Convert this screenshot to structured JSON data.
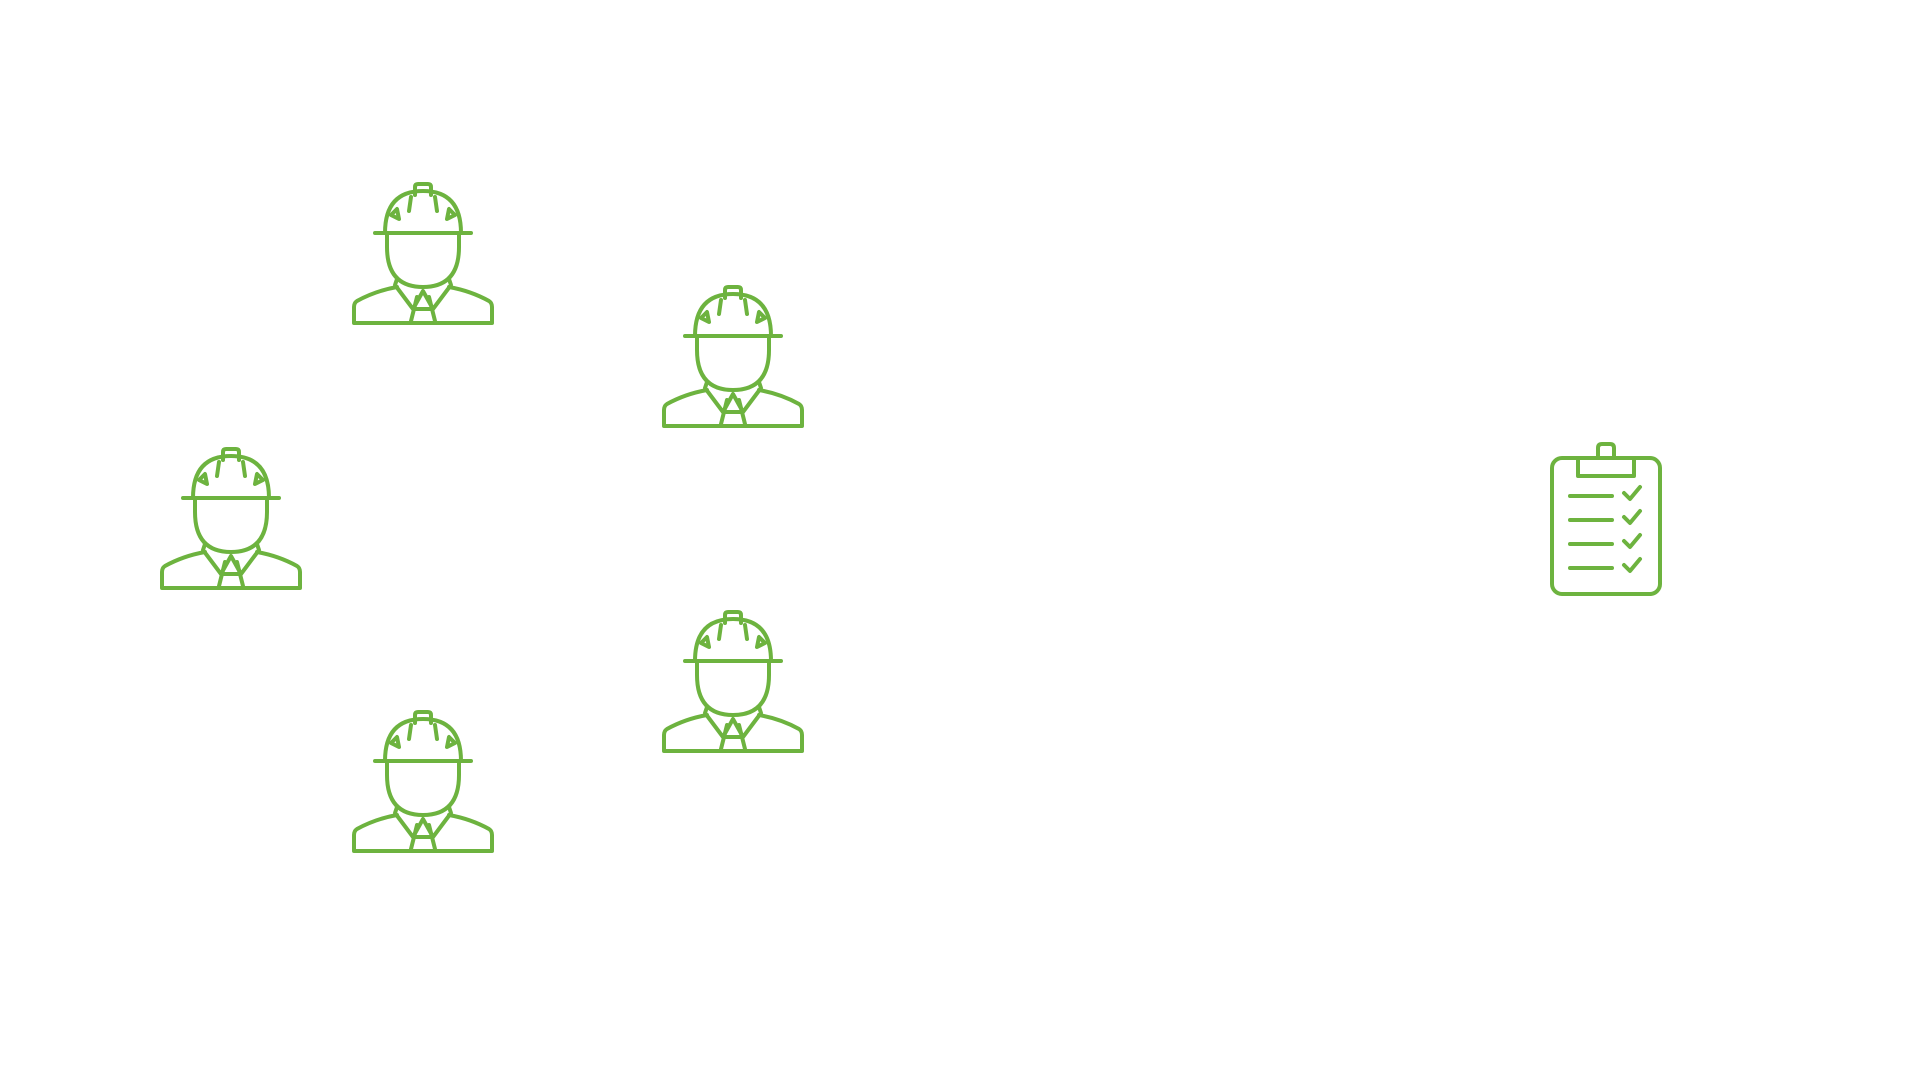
{
  "colors": {
    "background": "#ffffff",
    "icon_stroke": "#6db33f"
  },
  "icons": {
    "workers": [
      {
        "name": "construction-worker-icon"
      },
      {
        "name": "construction-worker-icon"
      },
      {
        "name": "construction-worker-icon"
      },
      {
        "name": "construction-worker-icon"
      },
      {
        "name": "construction-worker-icon"
      }
    ],
    "checklist": {
      "name": "clipboard-checklist-icon",
      "items_checked": 4,
      "items_total": 4
    }
  }
}
